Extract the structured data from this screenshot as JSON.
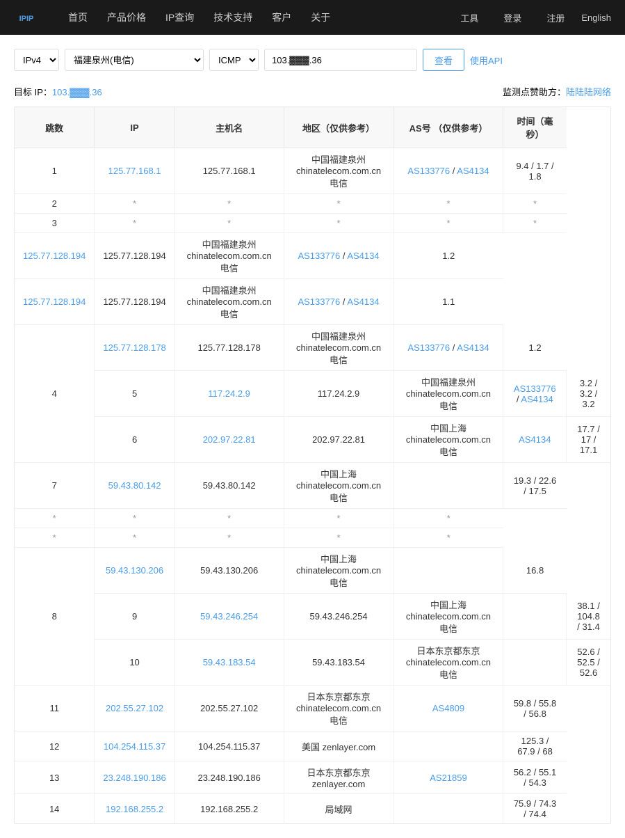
{
  "header": {
    "logo_text": "IPIP",
    "nav_items": [
      "首页",
      "产品价格",
      "IP查询",
      "技术支持",
      "客户",
      "关于"
    ],
    "right_items": [
      "工具",
      "登录",
      "注册"
    ],
    "lang": "English"
  },
  "search": {
    "ip_version": "IPv4",
    "location": "福建泉州(电信)",
    "protocol": "ICMP",
    "ip_value": "103.▓▓▓.36",
    "btn_query": "查看",
    "btn_api": "使用API"
  },
  "target": {
    "label": "目标 IP：",
    "ip": "103.▓▓▓.36",
    "monitor_label": "监测点赞助方：",
    "monitor_name": "陆陆陆网络"
  },
  "table": {
    "headers": [
      "跳数",
      "IP",
      "主机名",
      "地区（仅供参考）",
      "AS号 （仅供参考）",
      "时间（毫秒）"
    ],
    "rows": [
      {
        "hop": "1",
        "ip": "125.77.168.1",
        "ip_link": true,
        "hostname": "125.77.168.1",
        "region": "中国福建泉州 chinatelecom.com.cn 电信",
        "as": "AS133776 / AS4134",
        "as_link": true,
        "time": "9.4 / 1.7 / 1.8"
      },
      {
        "hop": "2",
        "ip": "*",
        "ip_link": false,
        "hostname": "*",
        "region": "*",
        "as": "*",
        "as_link": false,
        "time": "*"
      },
      {
        "hop": "3",
        "ip": "*",
        "ip_link": false,
        "hostname": "*",
        "region": "*",
        "as": "*",
        "as_link": false,
        "time": "*"
      },
      {
        "hop": "4",
        "multi": true,
        "entries": [
          {
            "ip": "125.77.128.178",
            "hostname": "125.77.128.178",
            "region": "中国福建泉州 chinatelecom.com.cn 电信",
            "as": "AS133776 / AS4134",
            "time": "1.2"
          },
          {
            "ip": "125.77.128.194",
            "hostname": "125.77.128.194",
            "region": "中国福建泉州 chinatelecom.com.cn 电信",
            "as": "AS133776 / AS4134",
            "time": "1.2"
          },
          {
            "ip": "125.77.128.194",
            "hostname": "125.77.128.194",
            "region": "中国福建泉州 chinatelecom.com.cn 电信",
            "as": "AS133776 / AS4134",
            "time": "1.1"
          }
        ]
      },
      {
        "hop": "5",
        "ip": "117.24.2.9",
        "ip_link": true,
        "hostname": "117.24.2.9",
        "region": "中国福建泉州 chinatelecom.com.cn 电信",
        "as": "AS133776 / AS4134",
        "as_link": true,
        "time": "3.2 / 3.2 / 3.2"
      },
      {
        "hop": "6",
        "ip": "202.97.22.81",
        "ip_link": true,
        "hostname": "202.97.22.81",
        "region": "中国上海 chinatelecom.com.cn 电信",
        "as": "AS4134",
        "as_link": true,
        "time": "17.7 / 17 / 17.1"
      },
      {
        "hop": "7",
        "ip": "59.43.80.142",
        "ip_link": true,
        "hostname": "59.43.80.142",
        "region": "中国上海 chinatelecom.com.cn 电信",
        "as": "",
        "as_link": false,
        "time": "19.3 / 22.6 / 17.5"
      },
      {
        "hop": "8",
        "multi": true,
        "entries": [
          {
            "ip": "59.43.130.206",
            "hostname": "59.43.130.206",
            "region": "中国上海 chinatelecom.com.cn 电信",
            "as": "",
            "time": "16.8"
          },
          {
            "ip": "*",
            "hostname": "*",
            "region": "*",
            "as": "*",
            "time": "*"
          },
          {
            "ip": "*",
            "hostname": "*",
            "region": "*",
            "as": "*",
            "time": "*"
          }
        ]
      },
      {
        "hop": "9",
        "ip": "59.43.246.254",
        "ip_link": true,
        "hostname": "59.43.246.254",
        "region": "中国上海 chinatelecom.com.cn 电信",
        "as": "",
        "as_link": false,
        "time": "38.1 / 104.8 / 31.4"
      },
      {
        "hop": "10",
        "ip": "59.43.183.54",
        "ip_link": true,
        "hostname": "59.43.183.54",
        "region": "日本东京都东京 chinatelecom.com.cn 电信",
        "as": "",
        "as_link": false,
        "time": "52.6 / 52.5 / 52.6"
      },
      {
        "hop": "11",
        "ip": "202.55.27.102",
        "ip_link": true,
        "hostname": "202.55.27.102",
        "region": "日本东京都东京 chinatelecom.com.cn 电信",
        "as": "AS4809",
        "as_link": true,
        "time": "59.8 / 55.8 / 56.8"
      },
      {
        "hop": "12",
        "ip": "104.254.115.37",
        "ip_link": true,
        "hostname": "104.254.115.37",
        "region": "美国 zenlayer.com",
        "as": "",
        "as_link": false,
        "time": "125.3 / 67.9 / 68"
      },
      {
        "hop": "13",
        "ip": "23.248.190.186",
        "ip_link": true,
        "hostname": "23.248.190.186",
        "region": "日本东京都东京 zenlayer.com",
        "as": "AS21859",
        "as_link": true,
        "time": "56.2 / 55.1 / 54.3"
      },
      {
        "hop": "14",
        "ip": "192.168.255.2",
        "ip_link": true,
        "hostname": "192.168.255.2",
        "region": "局域网",
        "as": "",
        "as_link": false,
        "time": "75.9 / 74.3 / 74.4"
      }
    ]
  }
}
